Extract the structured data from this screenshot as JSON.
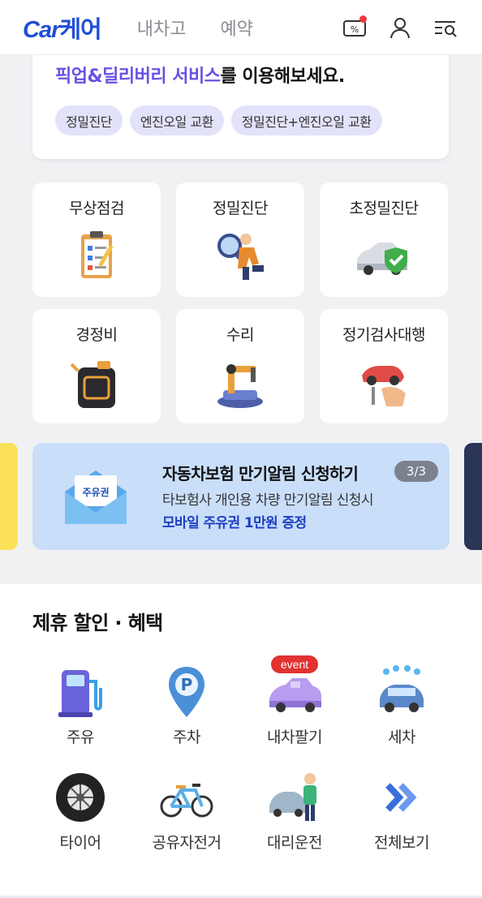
{
  "header": {
    "logo_latin": "Car",
    "logo_korean": "케어",
    "nav": [
      "내차고",
      "예약"
    ],
    "icons": [
      "coupon-icon",
      "user-icon",
      "menu-search-icon"
    ]
  },
  "promo": {
    "highlight": "픽업&딜리버리 서비스",
    "rest": "를 이용해보세요.",
    "chips": [
      "정밀진단",
      "엔진오일 교환",
      "정밀진단+엔진오일 교환"
    ]
  },
  "services": [
    {
      "label": "무상점검",
      "icon": "clipboard-icon"
    },
    {
      "label": "정밀진단",
      "icon": "magnifier-mechanic-icon"
    },
    {
      "label": "초정밀진단",
      "icon": "car-shield-icon"
    },
    {
      "label": "경정비",
      "icon": "oil-can-icon"
    },
    {
      "label": "수리",
      "icon": "robot-arm-icon"
    },
    {
      "label": "정기검사대행",
      "icon": "hand-car-icon"
    }
  ],
  "banner": {
    "envelope_label": "주유권",
    "title": "자동차보험 만기알림 신청하기",
    "pager": "3/3",
    "subtitle": "타보험사 개인용 차량 만기알림 신청시",
    "promo": "모바일 주유권 1만원 증정"
  },
  "benefits": {
    "title": "제휴 할인 · 혜택",
    "event_badge": "event",
    "items": [
      {
        "label": "주유",
        "icon": "gas-pump-icon"
      },
      {
        "label": "주차",
        "icon": "parking-pin-icon"
      },
      {
        "label": "내차팔기",
        "icon": "sell-car-icon"
      },
      {
        "label": "세차",
        "icon": "car-wash-icon"
      },
      {
        "label": "타이어",
        "icon": "tire-icon"
      },
      {
        "label": "공유자전거",
        "icon": "bicycle-icon"
      },
      {
        "label": "대리운전",
        "icon": "valet-driver-icon"
      },
      {
        "label": "전체보기",
        "icon": "double-chevron-icon"
      }
    ]
  },
  "colors": {
    "brand": "#1f4fd6",
    "highlight": "#6b4fe3",
    "chip_bg": "#e3e2fb",
    "banner_bg": "#c9def9",
    "promo_blue": "#1d3fc2",
    "event_red": "#e23232"
  }
}
